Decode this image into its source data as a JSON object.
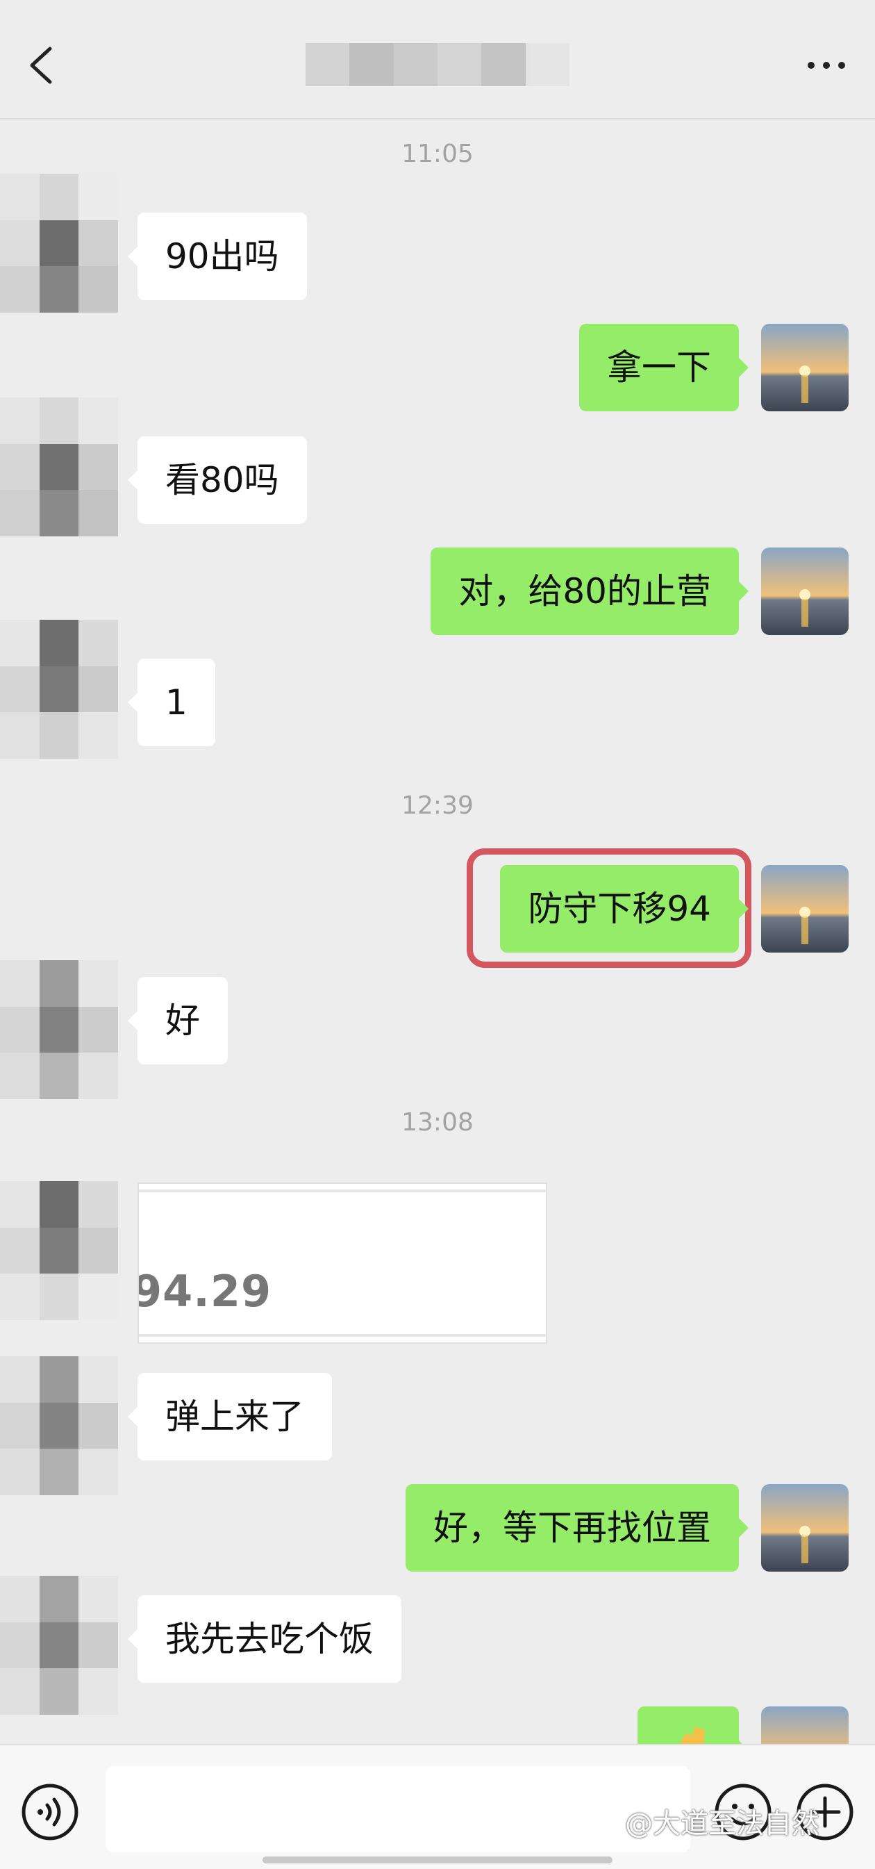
{
  "header": {
    "back_icon": "chevron-left-icon",
    "more_icon": "more-dots-icon"
  },
  "timestamps": [
    "11:05",
    "12:39",
    "13:08"
  ],
  "messages": [
    {
      "side": "in",
      "text": "90出吗"
    },
    {
      "side": "out",
      "text": "拿一下"
    },
    {
      "side": "in",
      "text": "看80吗"
    },
    {
      "side": "out",
      "text": "对，给80的止营"
    },
    {
      "side": "in",
      "text": "1"
    },
    {
      "side": "out",
      "text": "防守下移94",
      "highlighted": true
    },
    {
      "side": "in",
      "text": "好"
    },
    {
      "side": "in",
      "type": "image-card",
      "text": "94.29"
    },
    {
      "side": "in",
      "text": "弹上来了"
    },
    {
      "side": "out",
      "text": "好，等下再找位置"
    },
    {
      "side": "in",
      "text": "我先去吃个饭"
    },
    {
      "side": "out",
      "text": ""
    }
  ],
  "footer": {
    "voice_icon": "voice-icon",
    "emoji_icon": "emoji-icon",
    "plus_icon": "plus-icon",
    "watermark": "@大道至法自然"
  },
  "colors": {
    "background": "#ededed",
    "outgoing_bubble": "#95ec69",
    "incoming_bubble": "#ffffff",
    "highlight": "#d4565f"
  }
}
